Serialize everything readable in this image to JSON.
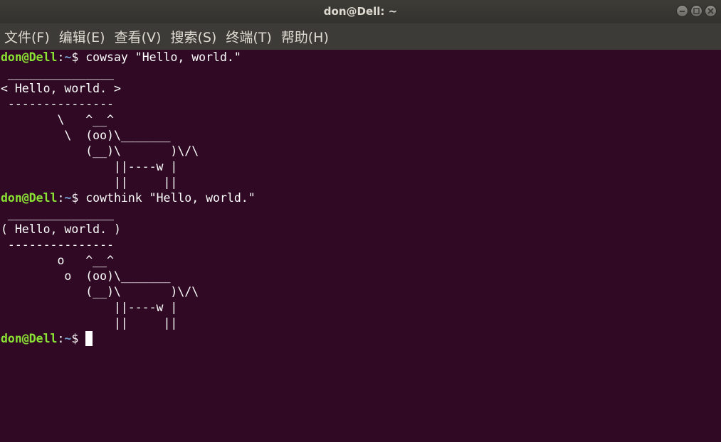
{
  "window": {
    "title": "don@Dell: ~"
  },
  "menu": {
    "items": [
      "文件(F)",
      "编辑(E)",
      "查看(V)",
      "搜索(S)",
      "终端(T)",
      "帮助(H)"
    ]
  },
  "terminal": {
    "prompt_user": "don@Dell",
    "prompt_colon": ":",
    "prompt_path": "~",
    "prompt_dollar": "$ ",
    "cmd1": "cowsay \"Hello, world.\"",
    "out1": [
      " _______________",
      "< Hello, world. >",
      " ---------------",
      "        \\   ^__^",
      "         \\  (oo)\\_______",
      "            (__)\\       )\\/\\",
      "                ||----w |",
      "                ||     ||"
    ],
    "cmd2": "cowthink \"Hello, world.\"",
    "out2": [
      " _______________",
      "( Hello, world. )",
      " ---------------",
      "        o   ^__^",
      "         o  (oo)\\_______",
      "            (__)\\       )\\/\\",
      "                ||----w |",
      "                ||     ||"
    ]
  },
  "colors": {
    "background": "#300a24",
    "prompt_user": "#8ae234",
    "prompt_path": "#729fcf"
  }
}
